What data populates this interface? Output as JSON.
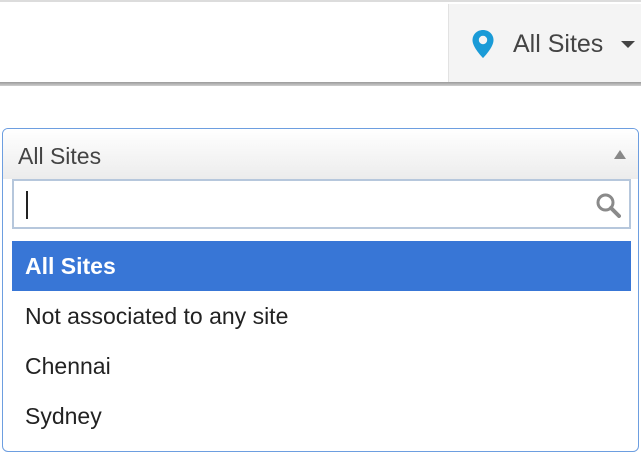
{
  "header": {
    "site_selector": {
      "icon": "map-pin-icon",
      "label": "All Sites",
      "accent": "#1a9bd7"
    }
  },
  "dropdown": {
    "selected": "All Sites",
    "search": {
      "value": "",
      "placeholder": ""
    },
    "options": [
      {
        "label": "All Sites",
        "highlighted": true
      },
      {
        "label": "Not associated to any site",
        "highlighted": false
      },
      {
        "label": "Chennai",
        "highlighted": false
      },
      {
        "label": "Sydney",
        "highlighted": false
      }
    ],
    "highlight_color": "#3876d6",
    "border_color": "#6d9ee0"
  }
}
